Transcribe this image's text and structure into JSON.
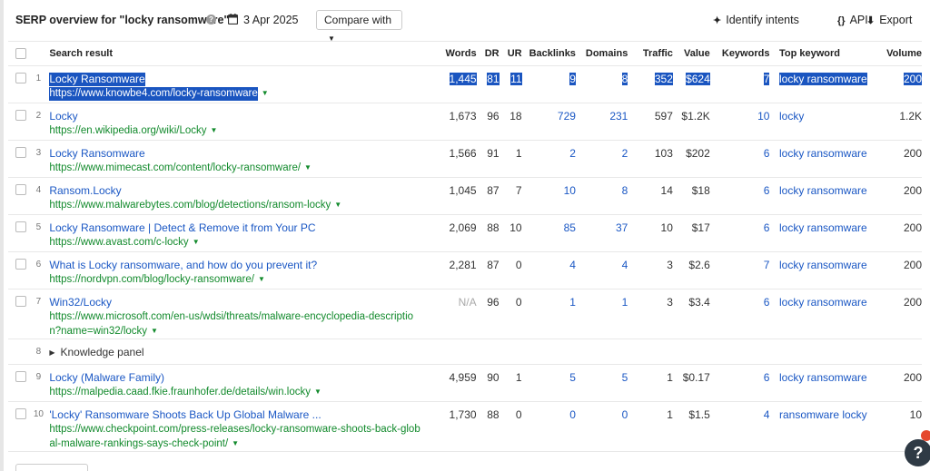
{
  "header": {
    "title": "SERP overview for \"locky ransomware\"",
    "date": "3 Apr 2025",
    "compare_label": "Compare with",
    "identify_label": "Identify intents",
    "api_label": "API",
    "export_label": "Export"
  },
  "columns": {
    "search_result": "Search result",
    "words": "Words",
    "dr": "DR",
    "ur": "UR",
    "backlinks": "Backlinks",
    "domains": "Domains",
    "traffic": "Traffic",
    "value": "Value",
    "keywords": "Keywords",
    "top_keyword": "Top keyword",
    "volume": "Volume"
  },
  "rows": [
    {
      "rank": "1",
      "title": "Locky Ransomware",
      "url": "https://www.knowbe4.com/locky-ransomware",
      "words": "1,445",
      "dr": "81",
      "ur": "11",
      "backlinks": "9",
      "domains": "8",
      "traffic": "352",
      "value": "$624",
      "keywords": "7",
      "top_keyword": "locky ransomware",
      "volume": "200"
    },
    {
      "rank": "2",
      "title": "Locky",
      "url": "https://en.wikipedia.org/wiki/Locky",
      "words": "1,673",
      "dr": "96",
      "ur": "18",
      "backlinks": "729",
      "domains": "231",
      "traffic": "597",
      "value": "$1.2K",
      "keywords": "10",
      "top_keyword": "locky",
      "volume": "1.2K"
    },
    {
      "rank": "3",
      "title": "Locky Ransomware",
      "url": "https://www.mimecast.com/content/locky-ransomware/",
      "words": "1,566",
      "dr": "91",
      "ur": "1",
      "backlinks": "2",
      "domains": "2",
      "traffic": "103",
      "value": "$202",
      "keywords": "6",
      "top_keyword": "locky ransomware",
      "volume": "200"
    },
    {
      "rank": "4",
      "title": "Ransom.Locky",
      "url": "https://www.malwarebytes.com/blog/detections/ransom-locky",
      "words": "1,045",
      "dr": "87",
      "ur": "7",
      "backlinks": "10",
      "domains": "8",
      "traffic": "14",
      "value": "$18",
      "keywords": "6",
      "top_keyword": "locky ransomware",
      "volume": "200"
    },
    {
      "rank": "5",
      "title": "Locky Ransomware | Detect & Remove it from Your PC",
      "url": "https://www.avast.com/c-locky",
      "words": "2,069",
      "dr": "88",
      "ur": "10",
      "backlinks": "85",
      "domains": "37",
      "traffic": "10",
      "value": "$17",
      "keywords": "6",
      "top_keyword": "locky ransomware",
      "volume": "200"
    },
    {
      "rank": "6",
      "title": "What is Locky ransomware, and how do you prevent it?",
      "url": "https://nordvpn.com/blog/locky-ransomware/",
      "words": "2,281",
      "dr": "87",
      "ur": "0",
      "backlinks": "4",
      "domains": "4",
      "traffic": "3",
      "value": "$2.6",
      "keywords": "7",
      "top_keyword": "locky ransomware",
      "volume": "200"
    },
    {
      "rank": "7",
      "title": "Win32/Locky",
      "url_line1": "https://www.microsoft.com/en-us/wdsi/threats/malware-encyclopedia-descriptio",
      "url_line2": "n?name=win32/locky",
      "words": "N/A",
      "dr": "96",
      "ur": "0",
      "backlinks": "1",
      "domains": "1",
      "traffic": "3",
      "value": "$3.4",
      "keywords": "6",
      "top_keyword": "locky ransomware",
      "volume": "200"
    },
    {
      "rank": "9",
      "title": "Locky (Malware Family)",
      "url": "https://malpedia.caad.fkie.fraunhofer.de/details/win.locky",
      "words": "4,959",
      "dr": "90",
      "ur": "1",
      "backlinks": "5",
      "domains": "5",
      "traffic": "1",
      "value": "$0.17",
      "keywords": "6",
      "top_keyword": "locky ransomware",
      "volume": "200"
    },
    {
      "rank": "10",
      "title": "'Locky' Ransomware Shoots Back Up Global Malware ...",
      "url_line1": "https://www.checkpoint.com/press-releases/locky-ransomware-shoots-back-glob",
      "url_line2": "al-malware-rankings-says-check-point/",
      "words": "1,730",
      "dr": "88",
      "ur": "0",
      "backlinks": "0",
      "domains": "0",
      "traffic": "1",
      "value": "$1.5",
      "keywords": "4",
      "top_keyword": "ransomware locky",
      "volume": "10"
    }
  ],
  "knowledge_panel": {
    "rank": "8",
    "label": "Knowledge panel"
  },
  "help": {
    "label": "?"
  }
}
